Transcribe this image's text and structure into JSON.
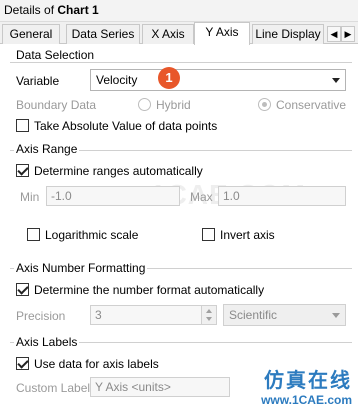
{
  "window": {
    "title_prefix": "Details of ",
    "title_bold": "Chart 1"
  },
  "tabs": [
    {
      "label": "General"
    },
    {
      "label": "Data Series"
    },
    {
      "label": "X Axis"
    },
    {
      "label": "Y Axis"
    },
    {
      "label": "Line Display"
    }
  ],
  "tab_scroll": {
    "left_icon": "chevron-left-icon",
    "right_icon": "chevron-right-icon"
  },
  "data_selection": {
    "title": "Data Selection",
    "variable_label": "Variable",
    "variable_value": "Velocity",
    "badge": "1",
    "boundary_label": "Boundary Data",
    "hybrid_label": "Hybrid",
    "conservative_label": "Conservative",
    "abs_label": "Take Absolute Value of data points"
  },
  "axis_range": {
    "title": "Axis Range",
    "auto_label": "Determine ranges automatically",
    "min_label": "Min",
    "min_value": "-1.0",
    "max_label": "Max",
    "max_value": "1.0",
    "log_label": "Logarithmic scale",
    "invert_label": "Invert axis"
  },
  "number_format": {
    "title": "Axis Number Formatting",
    "auto_label": "Determine the number format automatically",
    "precision_label": "Precision",
    "precision_value": "3",
    "format_value": "Scientific"
  },
  "axis_labels": {
    "title": "Axis Labels",
    "use_data_label": "Use data for axis labels",
    "custom_label": "Custom Label",
    "custom_value": "Y Axis <units>"
  },
  "watermark": "1CAE.COM",
  "brand": {
    "cn": "仿真在线",
    "url": "www.1CAE.com"
  }
}
